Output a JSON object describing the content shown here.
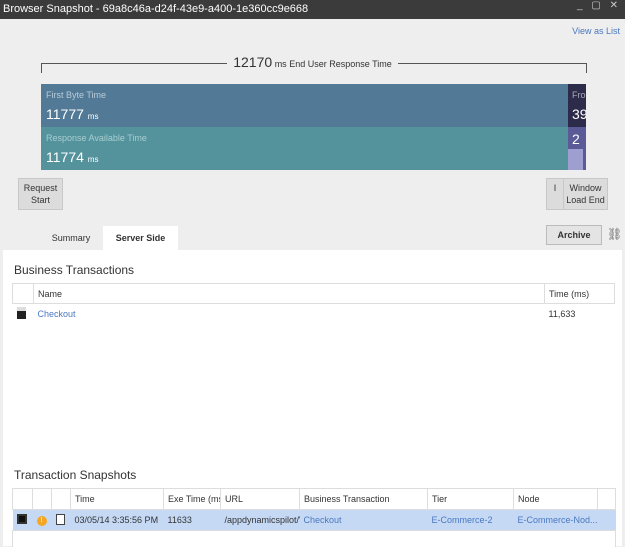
{
  "window": {
    "title": "Browser Snapshot - 69a8c46a-d24f-43e9-a400-1e360cc9e668",
    "controls": "_ ▢ ✕"
  },
  "view_as_list": "View as List",
  "timeline": {
    "total_value": "12170",
    "total_unit": "ms",
    "total_label": "End User Response Time",
    "first_byte": {
      "label": "First Byte Time",
      "value": "11777",
      "unit": "ms",
      "color": "#527a96"
    },
    "response_available": {
      "label": "Response Available Time",
      "value": "11774",
      "unit": "ms",
      "color": "#55939c"
    },
    "front_end": {
      "label": "Fro",
      "value": "39",
      "color": "#2c2c4a"
    },
    "dom": {
      "value": "2",
      "color": "#5a5a96"
    },
    "markers": {
      "request_start": "Request Start",
      "small": "I",
      "window_load_end": "Window Load End"
    }
  },
  "tabs": [
    {
      "label": "Summary",
      "active": false
    },
    {
      "label": "Server Side",
      "active": true
    }
  ],
  "archive_label": "Archive",
  "business_transactions": {
    "title": "Business Transactions",
    "columns": [
      "",
      "Name",
      "Time (ms)"
    ],
    "rows": [
      {
        "icon": "business-transaction-icon",
        "name": "Checkout",
        "time": "11,633"
      }
    ]
  },
  "transaction_snapshots": {
    "title": "Transaction Snapshots",
    "columns": [
      "",
      "",
      "",
      "Time",
      "Exe Time (ms)",
      "URL",
      "Business Transaction",
      "Tier",
      "Node",
      ""
    ],
    "rows": [
      {
        "time": "03/05/14 3:35:56 PM",
        "exe_time": "11633",
        "url": "/appdynamicspilot/Vi",
        "bt": "Checkout",
        "tier": "E-Commerce-2",
        "node": "E-Commerce-Nod..."
      }
    ]
  }
}
